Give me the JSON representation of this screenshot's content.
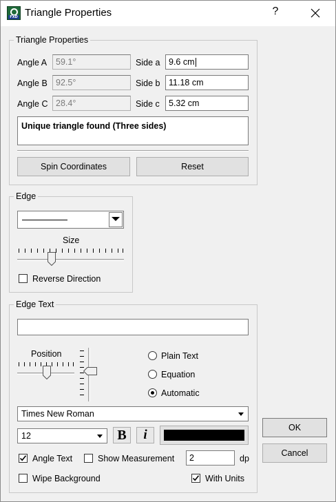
{
  "window": {
    "title": "Triangle Properties",
    "help": "?",
    "icon": "fxd-app-icon"
  },
  "triangle_group": {
    "label": "Triangle Properties",
    "angle_a": {
      "label": "Angle A",
      "value": "59.1°"
    },
    "angle_b": {
      "label": "Angle B",
      "value": "92.5°"
    },
    "angle_c": {
      "label": "Angle C",
      "value": "28.4°"
    },
    "side_a": {
      "label": "Side a",
      "value": "9.6 cm"
    },
    "side_b": {
      "label": "Side b",
      "value": "11.18 cm"
    },
    "side_c": {
      "label": "Side c",
      "value": "5.32 cm"
    },
    "message": "Unique triangle found (Three sides)",
    "spin_button": "Spin Coordinates",
    "reset_button": "Reset"
  },
  "edge_group": {
    "label": "Edge",
    "size_label": "Size",
    "reverse_label": "Reverse Direction",
    "reverse_checked": false
  },
  "edge_text_group": {
    "label": "Edge Text",
    "text_value": "",
    "position_label": "Position",
    "radio": {
      "plain": "Plain Text",
      "equation": "Equation",
      "automatic": "Automatic",
      "selected": "automatic"
    },
    "font": "Times New Roman",
    "font_size": "12",
    "bold_label": "B",
    "italic_label": "i",
    "color": "#000000",
    "angle_text_label": "Angle Text",
    "angle_text_checked": true,
    "show_measurement_label": "Show Measurement",
    "show_measurement_checked": false,
    "dp_value": "2",
    "dp_label": "dp",
    "wipe_background_label": "Wipe Background",
    "wipe_background_checked": false,
    "with_units_label": "With Units",
    "with_units_checked": true
  },
  "buttons": {
    "ok": "OK",
    "cancel": "Cancel"
  }
}
